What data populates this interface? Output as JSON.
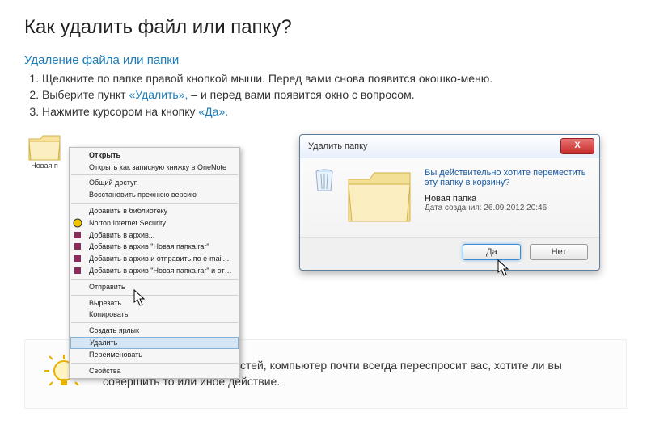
{
  "title": "Как удалить файл или папку?",
  "subtitle": "Удаление файла или папки",
  "steps": {
    "s1a": "Щелкните по папке правой кнопкой мыши. Перед вами снова появится окошко-меню.",
    "s2a": "Выберите пункт ",
    "s2b": "«Удалить»,",
    "s2c": " – и перед вами появится окно с вопросом.",
    "s3a": "Нажмите курсором на кнопку ",
    "s3b": "«Да»."
  },
  "folder_label": "Новая п",
  "context_menu": {
    "open": "Открыть",
    "onenote": "Открыть как записную книжку в OneNote",
    "share": "Общий доступ",
    "restore": "Восстановить прежнюю версию",
    "library": "Добавить в библиотеку",
    "norton": "Norton Internet Security",
    "add_archive": "Добавить в архив...",
    "add_rar": "Добавить в архив \"Новая папка.rar\"",
    "add_email": "Добавить в архив и отправить по e-mail...",
    "add_rar_email": "Добавить в архив \"Новая папка.rar\" и отправить по e-mail",
    "send": "Отправить",
    "cut": "Вырезать",
    "copy": "Копировать",
    "shortcut": "Создать ярлык",
    "delete": "Удалить",
    "rename": "Переименовать",
    "properties": "Свойства"
  },
  "dialog": {
    "title": "Удалить папку",
    "question": "Вы действительно хотите переместить эту папку в корзину?",
    "name": "Новая папка",
    "date": "Дата создания: 26.09.2012 20:46",
    "yes": "Да",
    "no": "Нет"
  },
  "tip": "Чтобы избежать случайностей, компьютер почти всегда переспросит вас, хотите ли вы совершить то или иное действие."
}
